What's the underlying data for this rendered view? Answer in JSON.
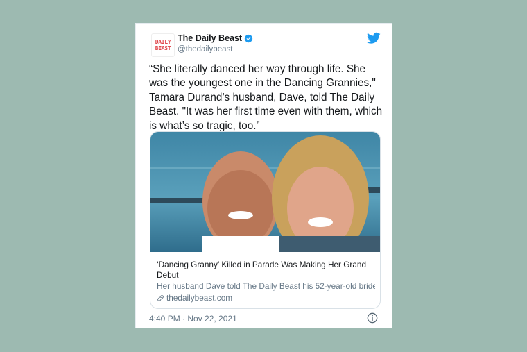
{
  "tweet": {
    "author_name": "The Daily Beast",
    "author_handle": "@thedailybeast",
    "avatar_text_top": "DAILY",
    "avatar_text_bottom": "BEAST",
    "text": "“She literally danced her way through life. She was the youngest one in the Dancing Grannies,\" Tamara Durand’s husband, Dave, told The Daily Beast. \"It was her first time even with them, which is what’s so tragic, too.”",
    "timestamp": "4:40 PM · Nov 22, 2021"
  },
  "card": {
    "title": "‘Dancing Granny’ Killed in Parade Was Making Her Grand Debut",
    "description": "Her husband Dave told The Daily Beast his 52-year-old bride...",
    "domain": "thedailybeast.com",
    "image_alt": "photo of a smiling couple in front of the sea"
  },
  "colors": {
    "background": "#9dbab1",
    "twitter_blue": "#1d9bf0",
    "brand_red": "#e0474c",
    "secondary_text": "#657786"
  },
  "icons": [
    "verified-badge-icon",
    "twitter-bird-icon",
    "link-icon",
    "info-icon"
  ]
}
